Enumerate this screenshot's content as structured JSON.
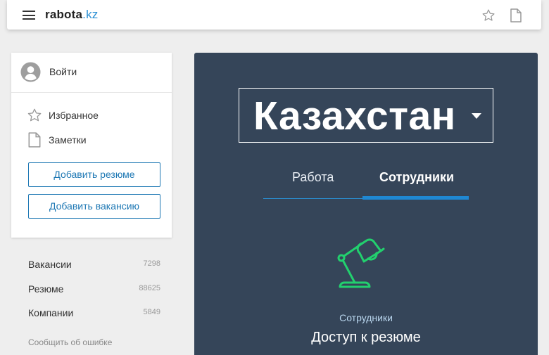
{
  "header": {
    "logo_main": "rabota",
    "logo_domain": ".kz",
    "icons": {
      "menu": "menu-icon",
      "favorites": "star-icon",
      "notes": "note-icon"
    }
  },
  "sidebar": {
    "login_label": "Войти",
    "favorites_label": "Избранное",
    "notes_label": "Заметки",
    "add_resume_label": "Добавить резюме",
    "add_vacancy_label": "Добавить вакансию",
    "stats": [
      {
        "label": "Вакансии",
        "count": "7298"
      },
      {
        "label": "Резюме",
        "count": "88625"
      },
      {
        "label": "Компании",
        "count": "5849"
      }
    ],
    "report_error_label": "Сообщить об ошибке"
  },
  "hero": {
    "country": "Казахстан",
    "tabs": [
      {
        "label": "Работа",
        "active": false
      },
      {
        "label": "Сотрудники",
        "active": true
      }
    ],
    "section_label": "Сотрудники",
    "title": "Доступ к резюме",
    "icon": "desk-lamp-icon"
  },
  "colors": {
    "accent": "#1f88d3",
    "hero_background": "#354559",
    "lamp_green": "#22d06e",
    "page_background": "#eeeeee"
  }
}
